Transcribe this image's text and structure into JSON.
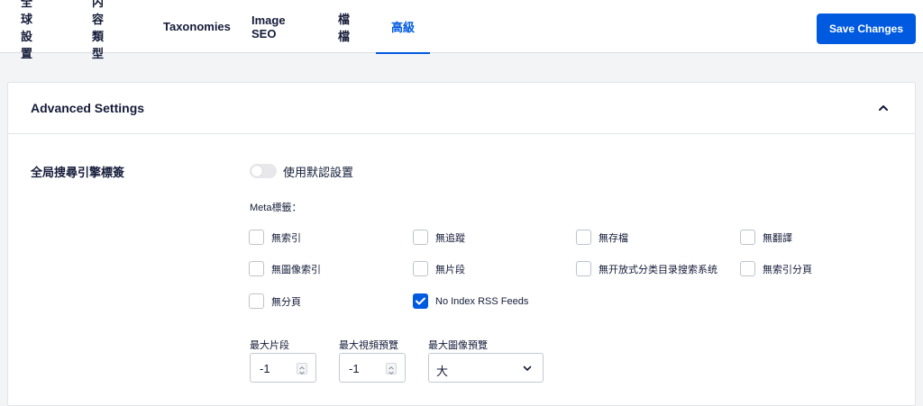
{
  "nav": {
    "tabs": [
      {
        "label": "全球設置",
        "active": false
      },
      {
        "label": "内容類型",
        "active": false
      },
      {
        "label": "Taxonomies",
        "active": false
      },
      {
        "label": "Image SEO",
        "active": false
      },
      {
        "label": "檔檔",
        "active": false
      },
      {
        "label": "高級",
        "active": true
      }
    ],
    "save_label": "Save Changes"
  },
  "colors": {
    "accent": "#005ae0",
    "text": "#141b38"
  },
  "card": {
    "title": "Advanced Settings",
    "collapse_icon": "chevron-up-icon"
  },
  "robots": {
    "section_label": "全局搜尋引擎標簽",
    "toggle_label": "使用默認設置",
    "toggle_on": false,
    "meta_label": "Meta標籤：",
    "checkboxes": [
      {
        "label": "無索引",
        "checked": false
      },
      {
        "label": "無追蹤",
        "checked": false
      },
      {
        "label": "無存檔",
        "checked": false
      },
      {
        "label": "無翻譯",
        "checked": false
      },
      {
        "label": "無圖像索引",
        "checked": false
      },
      {
        "label": "無片段",
        "checked": false
      },
      {
        "label": "無开放式分类目录搜索系统",
        "checked": false
      },
      {
        "label": "無索引分頁",
        "checked": false
      },
      {
        "label": "無分頁",
        "checked": false
      },
      {
        "label": "No Index RSS Feeds",
        "checked": true
      }
    ],
    "max_snippet": {
      "label": "最大片段",
      "value": "-1"
    },
    "max_video_preview": {
      "label": "最大視頻預覽",
      "value": "-1"
    },
    "max_image_preview": {
      "label": "最大圖像預覽",
      "value": "大"
    }
  }
}
